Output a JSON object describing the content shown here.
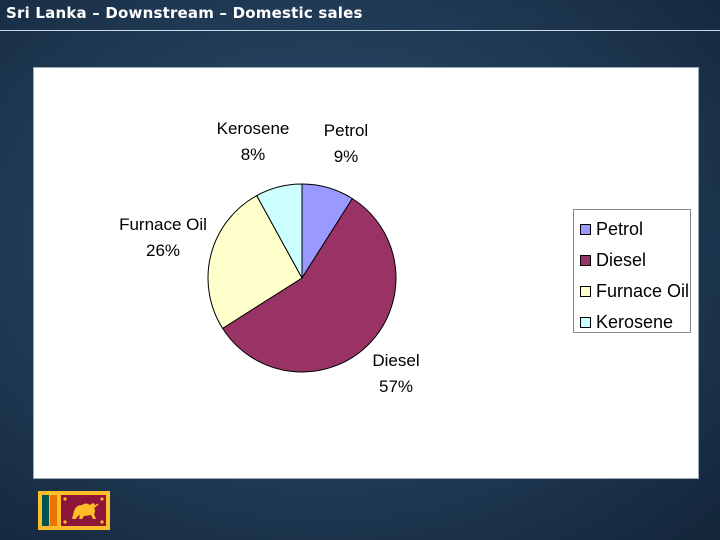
{
  "slide": {
    "title": "Sri Lanka – Downstream – Domestic sales"
  },
  "chart_data": {
    "type": "pie",
    "title": "",
    "categories": [
      "Petrol",
      "Diesel",
      "Furnace Oil",
      "Kerosene"
    ],
    "values": [
      9,
      57,
      26,
      8
    ],
    "value_labels": [
      "9%",
      "57%",
      "26%",
      "8%"
    ],
    "colors": [
      "#9999FF",
      "#993366",
      "#FFFFCC",
      "#CCFFFF"
    ],
    "start_angle_deg": 0,
    "direction": "clockwise",
    "legend": {
      "position": "right",
      "entries": [
        "Petrol",
        "Diesel",
        "Furnace Oil",
        "Kerosene"
      ]
    }
  },
  "flag": {
    "icon": "sri-lanka-flag-icon",
    "colors": {
      "border": "#FFBE29",
      "green": "#00534E",
      "orange": "#EB7400",
      "maroon": "#8D153A"
    }
  }
}
